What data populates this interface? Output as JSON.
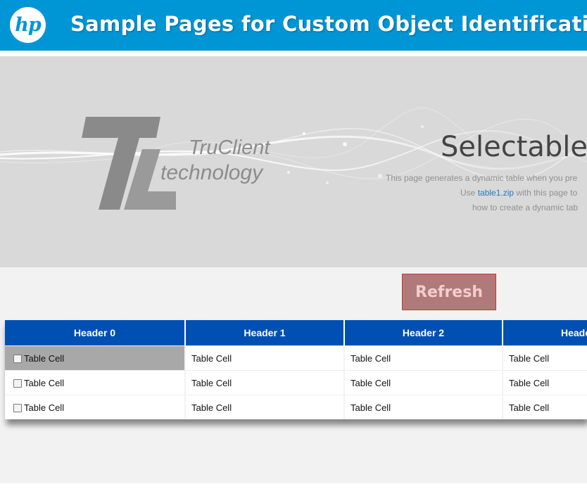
{
  "header": {
    "logo_text": "hp",
    "title": "Sample Pages for Custom Object Identification",
    "background_color": "#0096d6"
  },
  "banner": {
    "logo_letters": "TC",
    "logo_word_1": "TruClient",
    "logo_word_2": "technology",
    "heading": "Selectable c",
    "desc_line_1": "This page generates a dynamic table when you pre",
    "desc_line_2_prefix": "Use ",
    "desc_line_2_link": "table1.zip",
    "desc_line_2_suffix": " with this page to",
    "desc_line_3": "how to create a dynamic tab"
  },
  "refresh_button": {
    "label": "Refresh",
    "fill_color": "#b07a7a",
    "border_color": "#c0392b"
  },
  "table": {
    "header_color": "#0050b4",
    "headers": [
      "Header 0",
      "Header 1",
      "Header 2",
      "Heade"
    ],
    "rows": [
      {
        "selected": true,
        "checked": false,
        "cells": [
          "Table Cell",
          "Table Cell",
          "Table Cell",
          "Table Cell"
        ]
      },
      {
        "selected": false,
        "checked": false,
        "cells": [
          "Table Cell",
          "Table Cell",
          "Table Cell",
          "Table Cell"
        ]
      },
      {
        "selected": false,
        "checked": false,
        "cells": [
          "Table Cell",
          "Table Cell",
          "Table Cell",
          "Table Cell"
        ]
      }
    ]
  }
}
